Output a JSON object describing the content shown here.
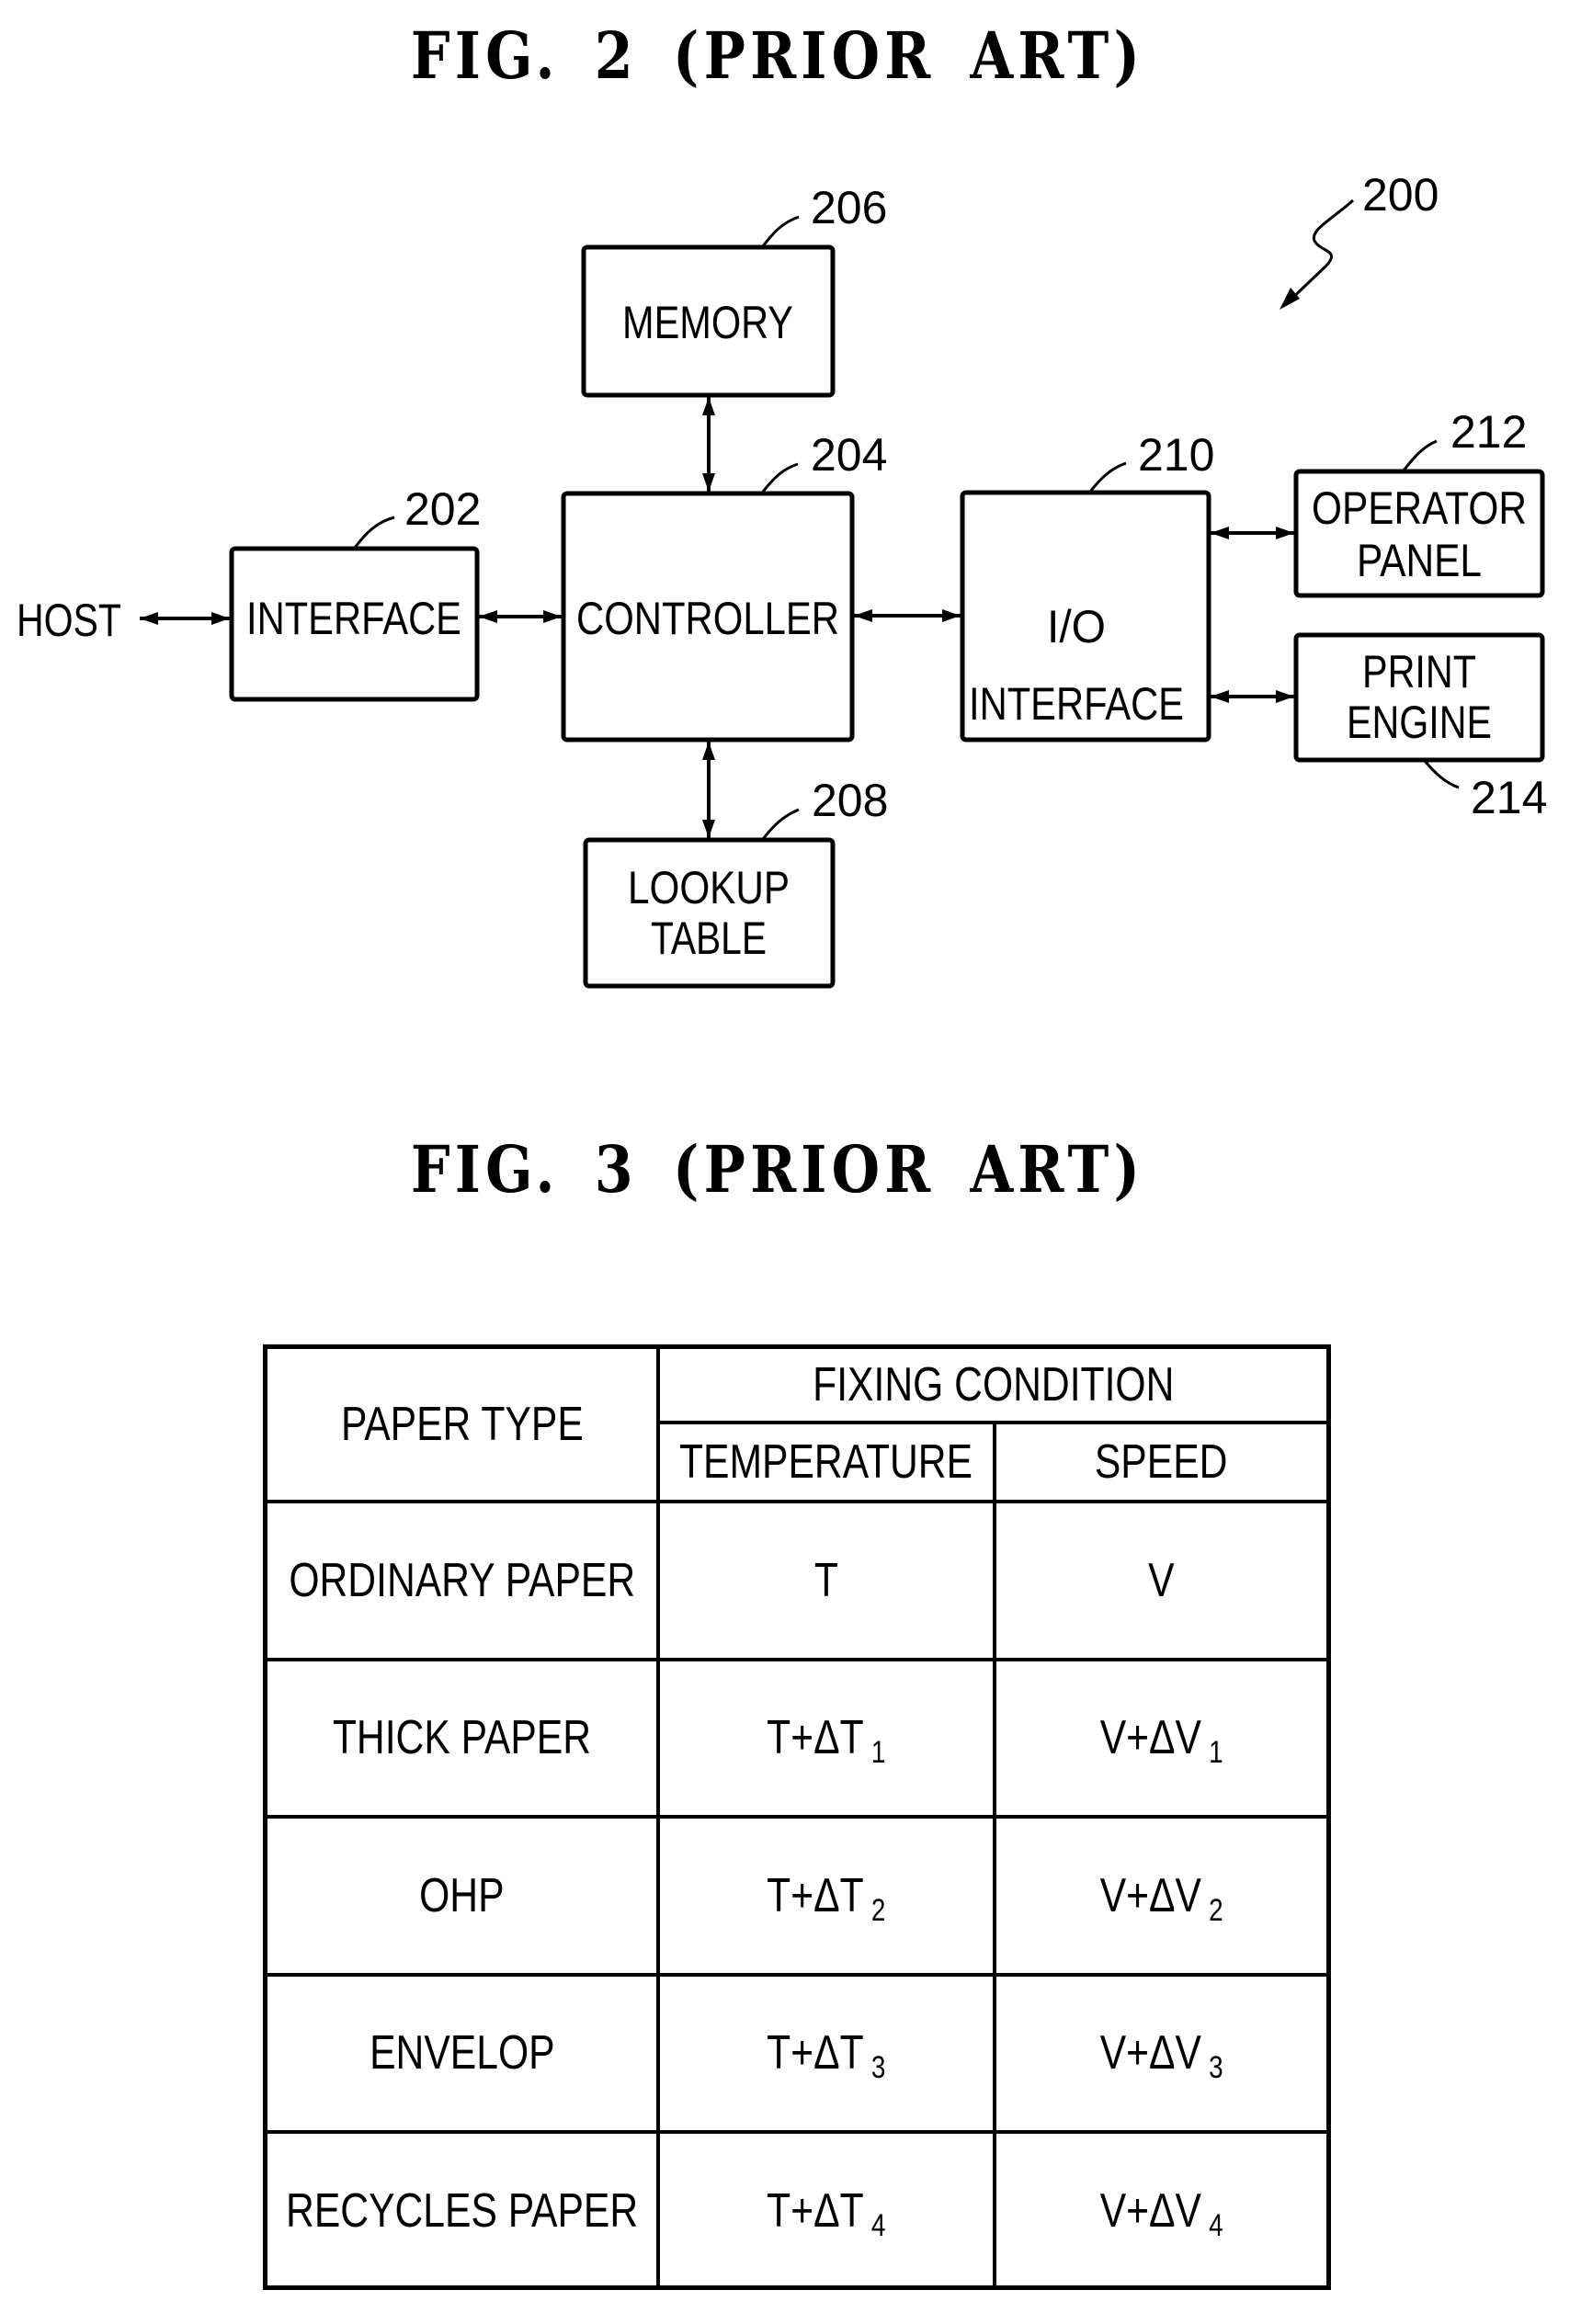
{
  "figure2": {
    "title": "FIG. 2 (PRIOR ART)",
    "system_ref": "200",
    "external": "HOST",
    "blocks": {
      "interface": {
        "label_lines": [
          "INTERFACE"
        ],
        "ref": "202"
      },
      "controller": {
        "label_lines": [
          "CONTROLLER"
        ],
        "ref": "204"
      },
      "memory": {
        "label_lines": [
          "MEMORY"
        ],
        "ref": "206"
      },
      "lookup_table": {
        "label_lines": [
          "LOOKUP",
          "TABLE"
        ],
        "ref": "208"
      },
      "io_interface": {
        "label_lines": [
          "I/O",
          "INTERFACE"
        ],
        "ref": "210"
      },
      "operator_panel": {
        "label_lines": [
          "OPERATOR",
          "PANEL"
        ],
        "ref": "212"
      },
      "print_engine": {
        "label_lines": [
          "PRINT",
          "ENGINE"
        ],
        "ref": "214"
      }
    },
    "connections": [
      {
        "from": "HOST",
        "to": "interface",
        "type": "bidirectional"
      },
      {
        "from": "interface",
        "to": "controller",
        "type": "bidirectional"
      },
      {
        "from": "memory",
        "to": "controller",
        "type": "bidirectional"
      },
      {
        "from": "controller",
        "to": "lookup_table",
        "type": "bidirectional"
      },
      {
        "from": "controller",
        "to": "io_interface",
        "type": "bidirectional"
      },
      {
        "from": "io_interface",
        "to": "operator_panel",
        "type": "bidirectional"
      },
      {
        "from": "io_interface",
        "to": "print_engine",
        "type": "bidirectional"
      }
    ]
  },
  "figure3": {
    "title": "FIG. 3 (PRIOR ART)",
    "table": {
      "header": {
        "paper_type": "PAPER TYPE",
        "group": "FIXING CONDITION",
        "temperature": "TEMPERATURE",
        "speed": "SPEED"
      },
      "rows": [
        {
          "paper": "ORDINARY PAPER",
          "temp": "T",
          "temp_sub": "",
          "speed": "V",
          "speed_sub": ""
        },
        {
          "paper": "THICK PAPER",
          "temp": "T+ΔT",
          "temp_sub": "1",
          "speed": "V+ΔV",
          "speed_sub": "1"
        },
        {
          "paper": "OHP",
          "temp": "T+ΔT",
          "temp_sub": "2",
          "speed": "V+ΔV",
          "speed_sub": "2"
        },
        {
          "paper": "ENVELOP",
          "temp": "T+ΔT",
          "temp_sub": "3",
          "speed": "V+ΔV",
          "speed_sub": "3"
        },
        {
          "paper": "RECYCLES PAPER",
          "temp": "T+ΔT",
          "temp_sub": "4",
          "speed": "V+ΔV",
          "speed_sub": "4"
        }
      ]
    }
  }
}
